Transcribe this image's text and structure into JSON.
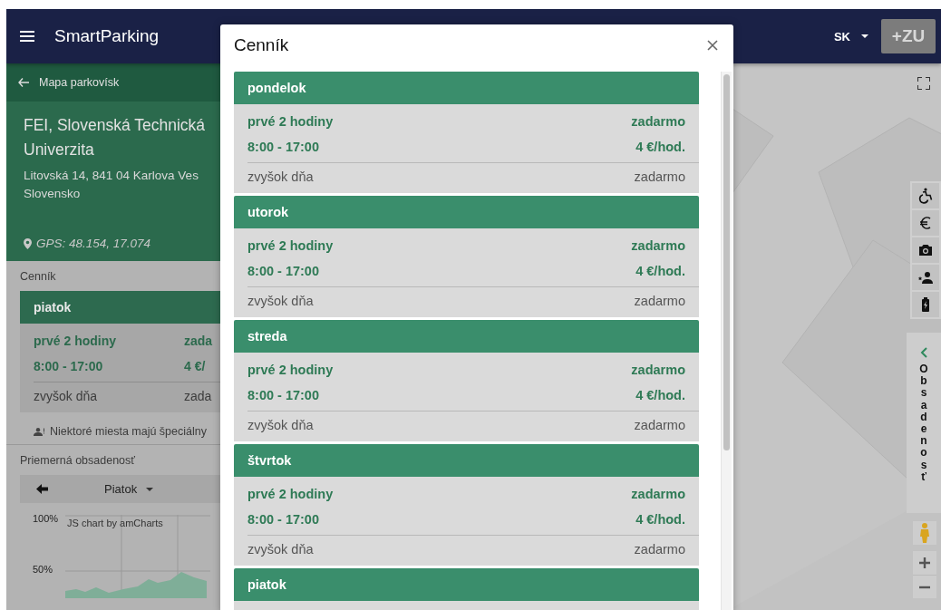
{
  "header": {
    "title": "SmartParking",
    "language": "SK",
    "logo": "+ZU"
  },
  "sidebar": {
    "back_link": "Mapa parkovísk",
    "place": "FEI, Slovenská Technická Univerzita",
    "address": [
      "Litovská 14, 841 04 Karlova Ves",
      "Slovensko"
    ],
    "gps": "GPS: 48.154, 17.074",
    "pricing": {
      "label": "Cenník",
      "day": "piatok",
      "rows": [
        {
          "kind": "rate",
          "label": "prvé 2 hodiny",
          "price": "zada"
        },
        {
          "kind": "rate",
          "label": "8:00 - 17:00",
          "price": "4 €/"
        },
        {
          "kind": "rest",
          "label": "zvyšok dňa",
          "price": "zada"
        }
      ],
      "note": "Niektoré miesta majú špeciálny"
    },
    "occupancy": {
      "label": "Priemerná obsadenosť",
      "day": "Piatok",
      "y_labels": [
        "100%",
        "50%"
      ],
      "credit": "JS chart by amCharts"
    }
  },
  "map": {
    "occupancy_panel": "Obsadenosť"
  },
  "modal": {
    "title": "Cenník",
    "days": [
      {
        "name": "pondelok",
        "rows": [
          {
            "kind": "rate",
            "label": "prvé 2 hodiny",
            "price": "zadarmo"
          },
          {
            "kind": "rate",
            "label": "8:00 - 17:00",
            "price": "4 €/hod."
          },
          {
            "kind": "rest",
            "label": "zvyšok dňa",
            "price": "zadarmo"
          }
        ]
      },
      {
        "name": "utorok",
        "rows": [
          {
            "kind": "rate",
            "label": "prvé 2 hodiny",
            "price": "zadarmo"
          },
          {
            "kind": "rate",
            "label": "8:00 - 17:00",
            "price": "4 €/hod."
          },
          {
            "kind": "rest",
            "label": "zvyšok dňa",
            "price": "zadarmo"
          }
        ]
      },
      {
        "name": "streda",
        "rows": [
          {
            "kind": "rate",
            "label": "prvé 2 hodiny",
            "price": "zadarmo"
          },
          {
            "kind": "rate",
            "label": "8:00 - 17:00",
            "price": "4 €/hod."
          },
          {
            "kind": "rest",
            "label": "zvyšok dňa",
            "price": "zadarmo"
          }
        ]
      },
      {
        "name": "štvrtok",
        "rows": [
          {
            "kind": "rate",
            "label": "prvé 2 hodiny",
            "price": "zadarmo"
          },
          {
            "kind": "rate",
            "label": "8:00 - 17:00",
            "price": "4 €/hod."
          },
          {
            "kind": "rest",
            "label": "zvyšok dňa",
            "price": "zadarmo"
          }
        ]
      },
      {
        "name": "piatok"
      }
    ]
  }
}
